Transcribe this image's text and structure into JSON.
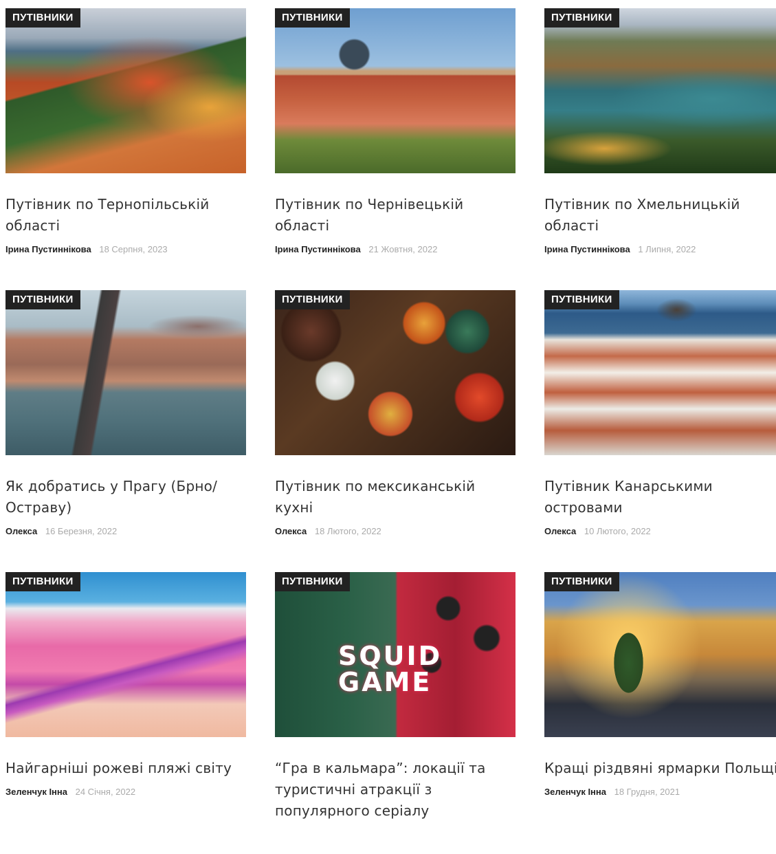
{
  "cards": [
    {
      "category": "ПУТІВНИКИ",
      "title": "Путівник по Тернопільській області",
      "author": "Ірина Пустиннікова",
      "date": "18 Серпня, 2023",
      "image": "ternopil-autumn-forest-photo"
    },
    {
      "category": "ПУТІВНИКИ",
      "title": "Путівник по Чернівецькій області",
      "author": "Ірина Пустиннікова",
      "date": "21 Жовтня, 2022",
      "image": "chernivtsi-university-photo"
    },
    {
      "category": "ПУТІВНИКИ",
      "title": "Путівник по Хмельницькій області",
      "author": "Ірина Пустиннікова",
      "date": "1 Липня, 2022",
      "image": "khmelnytskyi-river-canyon-photo"
    },
    {
      "category": "ПУТІВНИКИ",
      "title": "Як добратись у Прагу (Брно/Остраву)",
      "author": "Олекса",
      "date": "16 Березня, 2022",
      "image": "prague-charles-bridge-photo"
    },
    {
      "category": "ПУТІВНИКИ",
      "title": "Путівник по мексиканській кухні",
      "author": "Олекса",
      "date": "18 Лютого, 2022",
      "image": "mexican-food-table-photo"
    },
    {
      "category": "ПУТІВНИКИ",
      "title": "Путівник Канарськими островами",
      "author": "Олекса",
      "date": "10 Лютого, 2022",
      "image": "canary-islands-town-photo"
    },
    {
      "category": "ПУТІВНИКИ",
      "title": "Найгарніші рожеві пляжі світу",
      "author": "Зеленчук Інна",
      "date": "24 Січня, 2022",
      "image": "pink-beach-photo"
    },
    {
      "category": "ПУТІВНИКИ",
      "title": "“Гра в кальмара”: локації та туристичні атракції з популярного серіалу",
      "author": "",
      "date": "",
      "image": "squid-game-poster",
      "overlay_text": "SQUID GAME"
    },
    {
      "category": "ПУТІВНИКИ",
      "title": "Кращі різдвяні ярмарки Польщі",
      "author": "Зеленчук Інна",
      "date": "18 Грудня, 2021",
      "image": "poland-christmas-market-photo"
    }
  ],
  "colors": {
    "badge_bg": "#222222",
    "badge_text": "#ffffff",
    "title_text": "#333333",
    "author_text": "#222222",
    "date_text": "#aaaaaa"
  }
}
